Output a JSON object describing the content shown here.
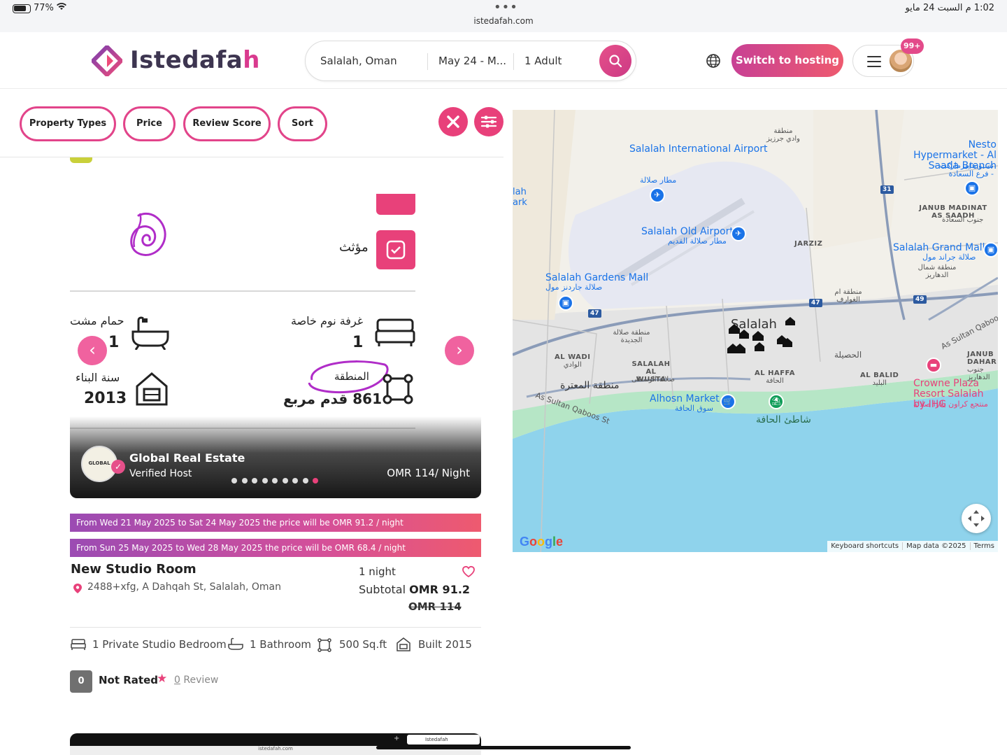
{
  "status_bar": {
    "battery": "77%",
    "url": "istedafah.com",
    "time": "1:02 م السبت 24 مايو"
  },
  "header": {
    "logo_text_main": "Istedafa",
    "logo_text_accent": "h",
    "search": {
      "location": "Salalah, Oman",
      "dates": "May 24 - M...",
      "guests": "1 Adult"
    },
    "switch_label": "Switch to hosting",
    "notification_count": "99+"
  },
  "filters": {
    "property_types": "Property Types",
    "price": "Price",
    "review_score": "Review Score",
    "sort": "Sort"
  },
  "listing": {
    "image_texts": {
      "verified": "مؤثث",
      "bath_label": "حمام مشت",
      "bath_count": "1",
      "bedroom_label": "غرفة نوم خاصة",
      "bedroom_count": "1",
      "year_label": "سنة البناء",
      "year_value": "2013",
      "area_label": "المنطقة",
      "area_value": "861 قدم مربع"
    },
    "host_name": "Global Real Estate",
    "host_status": "Verified Host",
    "host_logo_text": "GLOBAL",
    "price_per_night": "OMR 114/ Night",
    "price_notices": [
      "From Wed 21 May 2025 to Sat 24 May 2025 the price will be OMR 91.2 / night",
      "From Sun 25 May 2025 to Wed 28 May 2025 the price will be OMR 68.4 / night"
    ],
    "title": "New Studio Room",
    "address": "2488+xfg, A Dahqah St, Salalah, Oman",
    "nights": "1 night",
    "subtotal_label": "Subtotal",
    "subtotal_value": "OMR 91.2",
    "original_price": "OMR 114",
    "amenities": {
      "bedroom": "1 Private Studio Bedroom",
      "bathroom": "1 Bathroom",
      "area": "500 Sq.ft",
      "built": "Built 2015"
    },
    "rating_score": "0",
    "rating_text": "Not Rated",
    "review_count": "0",
    "review_suffix": " Review"
  },
  "map": {
    "labels": {
      "airport": "Salalah International Airport",
      "airport_ar": "مطار صلالة",
      "old_airport": "Salalah Old Airport",
      "old_airport_ar": "مطار صلالة القديم",
      "gardens_mall": "Salalah Gardens Mall",
      "gardens_mall_ar": "صلالة جاردنز مول",
      "nesto": "Nesto Hypermarket - Al Saada Branch",
      "nesto_ar": "نستو هايبرماركت - فرع السعادة -",
      "grand_mall": "Salalah Grand Mall",
      "grand_mall_ar": "صلالة جراند مول",
      "salalah": "Salalah",
      "jarziz": "JARZIZ",
      "janub_madinat": "JANUB MADINAT AS SAADH",
      "janub_madinat_ar": "جنوب السعادة",
      "al_wadi": "AL WADI",
      "al_wadi_ar": "الوادي",
      "salalah_wusta": "SALALAH AL WUSTA",
      "salalah_wusta_ar": "صلالة الوسطى",
      "al_haffa": "AL HAFFA",
      "al_haffa_ar": "الحافة",
      "al_balid": "AL BALID",
      "al_balid_ar": "البليد",
      "alhosn": "Alhosn Market",
      "alhosn_ar": "سوق الحافة",
      "haffa_beach_ar": "شاطئ الحافة",
      "crowne": "Crowne Plaza Resort Salalah by IHG",
      "crowne_ar": "منتجع كراون بلازا صلالة",
      "sultan_qaboos": "As Sultan Qaboos St",
      "sultan_qaboos_2": "As Sultan Qaboos",
      "new_salalah_ar": "منطقة صلالة الجديدة",
      "mutaqa_ar": "منطقة المعترة",
      "dahariz_ar": "منطقة شمال الدهاريز",
      "awafi_ar": "منطقة ام الغوارف",
      "husaylah_ar": "الحصيلة",
      "wadi_jarziz_ar": "منطقة وادي جرزيز",
      "janub_dahariz": "JANUB DAHAR",
      "janub_dahariz_ar": "جنوب الدهاريز",
      "park_frag": "lah ark"
    },
    "road_numbers": [
      "31",
      "47",
      "47",
      "49"
    ],
    "google": "Google",
    "attribution": [
      "Keyboard shortcuts",
      "Map data ©2025",
      "Terms"
    ]
  },
  "next_card": {
    "tab_title": "Istedafah",
    "url": "istedafah.com"
  },
  "colors": {
    "brand_pink": "#e8417a",
    "brand_purple": "#9b4bb3"
  }
}
